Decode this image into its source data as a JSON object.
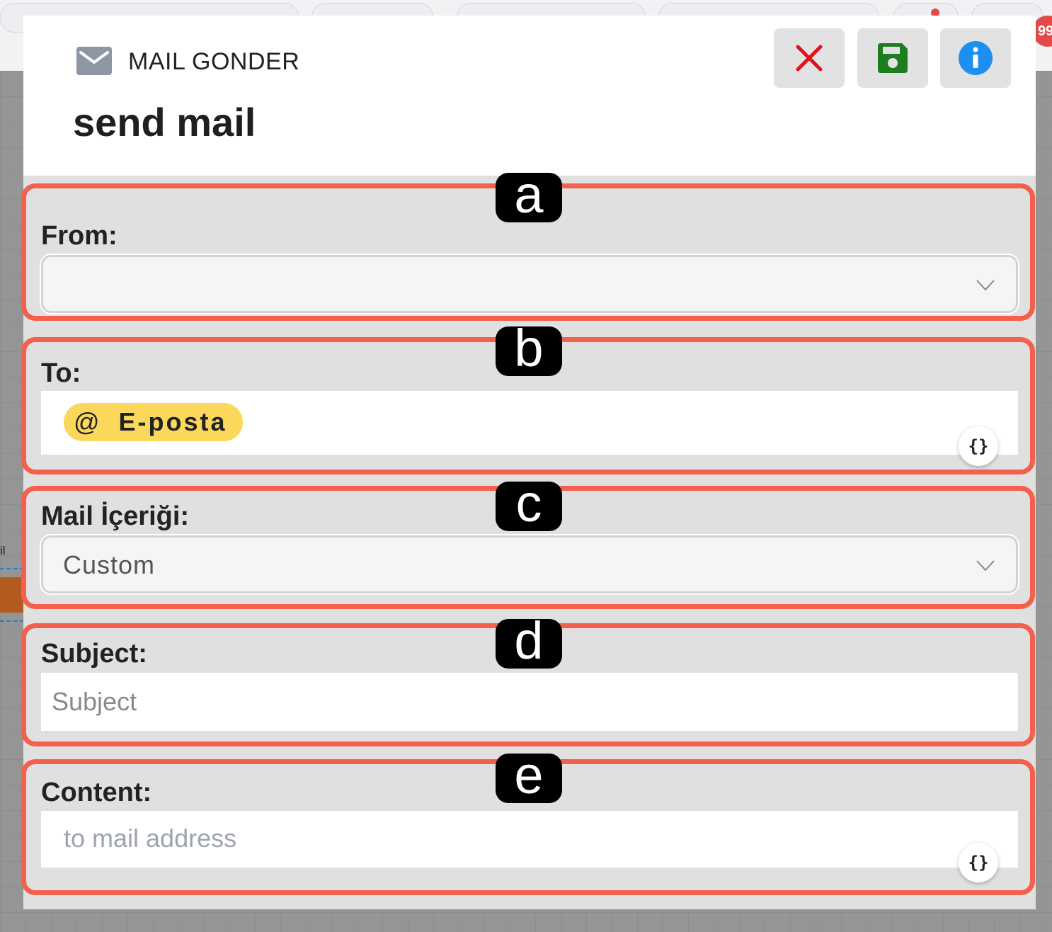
{
  "background": {
    "side_label": "il",
    "badge_text": "99"
  },
  "dialog": {
    "title": "MAIL GONDER",
    "subtitle": "send mail",
    "header_icon": "envelope-icon",
    "buttons": {
      "close_icon": "close-icon",
      "save_icon": "floppy-disk-icon",
      "info_icon": "info-icon"
    }
  },
  "fields": {
    "from": {
      "label": "From:",
      "value": ""
    },
    "to": {
      "label": "To:",
      "tag_symbol": "@",
      "tag_label": "E-posta",
      "variable_button": "{}"
    },
    "mail_content": {
      "label": "Mail İçeriği:",
      "value": "Custom"
    },
    "subject": {
      "label": "Subject:",
      "placeholder": "Subject"
    },
    "content": {
      "label": "Content:",
      "placeholder": "to mail address",
      "variable_button": "{}"
    }
  },
  "annotations": [
    "a",
    "b",
    "c",
    "d",
    "e"
  ],
  "colors": {
    "annotation_border": "#f4604e",
    "close_red": "#e3101b",
    "save_green": "#1e7d1e",
    "info_blue": "#1e8ff2",
    "tag_yellow": "#fbd75b"
  }
}
